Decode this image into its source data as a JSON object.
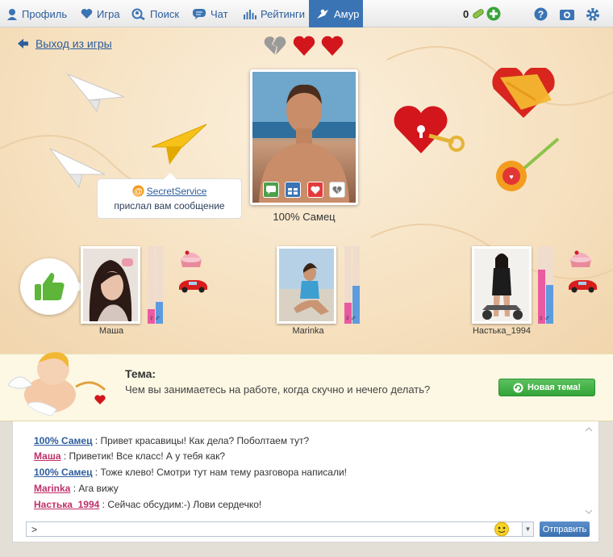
{
  "nav": {
    "items": [
      {
        "label": "Профиль",
        "icon": "profile-icon"
      },
      {
        "label": "Игра",
        "icon": "heart-icon"
      },
      {
        "label": "Поиск",
        "icon": "search-icon"
      },
      {
        "label": "Чат",
        "icon": "chat-icon"
      },
      {
        "label": "Рейтинги",
        "icon": "ratings-icon"
      },
      {
        "label": "Амур",
        "icon": "cupid-icon"
      }
    ],
    "coins": "0",
    "right_icons": [
      "help-icon",
      "camera-icon",
      "gear-icon"
    ]
  },
  "game": {
    "exit_label": "Выход из игры",
    "hearts": [
      "broken",
      "full",
      "full"
    ],
    "main_player": {
      "name": "100% Самец"
    },
    "notification": {
      "sender": "SecretService",
      "text": "прислал вам сообщение"
    },
    "girls": [
      {
        "name": "Маша",
        "female_level": 0.19,
        "male_level": 0.28
      },
      {
        "name": "Marinka",
        "female_level": 0.27,
        "male_level": 0.49
      },
      {
        "name": "Настька_1994",
        "female_level": 0.7,
        "male_level": 0.5
      }
    ],
    "gender_symbols": "♀♂"
  },
  "topic": {
    "label": "Тема:",
    "text": "Чем вы занимаетесь на работе, когда скучно и нечего делать?",
    "new_topic_label": "Новая тема!"
  },
  "chat": {
    "messages": [
      {
        "nick": "100% Самец",
        "text": " : Привет красавицы! Как дела? Поболтаем тут?",
        "color": "#2c5d9c"
      },
      {
        "nick": "Маша",
        "text": " : Приветик! Все класс! А у тебя как?",
        "color": "#c0306a"
      },
      {
        "nick": "100% Самец",
        "text": " : Тоже клево! Смотри тут нам тему разговора написали!",
        "color": "#2c5d9c"
      },
      {
        "nick": "Marinka",
        "text": " : Ага вижу",
        "color": "#c0306a"
      },
      {
        "nick": "Настька_1994",
        "text": " : Сейчас обсудим:-) Лови сердечко!",
        "color": "#c0306a"
      }
    ],
    "input_value": ">",
    "send_label": "Отправить"
  },
  "colors": {
    "accent": "#3b74b4",
    "link": "#2c5d9c",
    "female": "#c0306a",
    "green": "#33a438"
  }
}
